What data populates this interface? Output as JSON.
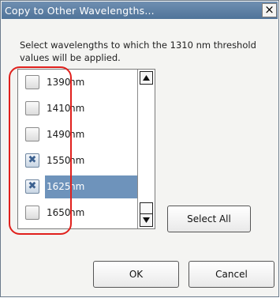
{
  "dialog": {
    "title": "Copy to Other Wavelengths...",
    "close_symbol": "×",
    "instruction": "Select wavelengths to which the 1310 nm threshold values will be applied."
  },
  "wavelengths": [
    {
      "value": "1390",
      "unit": "nm",
      "checked": false,
      "selected": false
    },
    {
      "value": "1410",
      "unit": "nm",
      "checked": false,
      "selected": false
    },
    {
      "value": "1490",
      "unit": "nm",
      "checked": false,
      "selected": false
    },
    {
      "value": "1550",
      "unit": "nm",
      "checked": true,
      "selected": false
    },
    {
      "value": "1625",
      "unit": "nm",
      "checked": true,
      "selected": true
    },
    {
      "value": "1650",
      "unit": "nm",
      "checked": false,
      "selected": false
    }
  ],
  "checkmark_symbol": "✖",
  "buttons": {
    "select_all": "Select All",
    "ok": "OK",
    "cancel": "Cancel"
  },
  "colors": {
    "title_bar": "#5a7ea6",
    "selection": "#6e93bb",
    "annotation": "#e0201c"
  }
}
